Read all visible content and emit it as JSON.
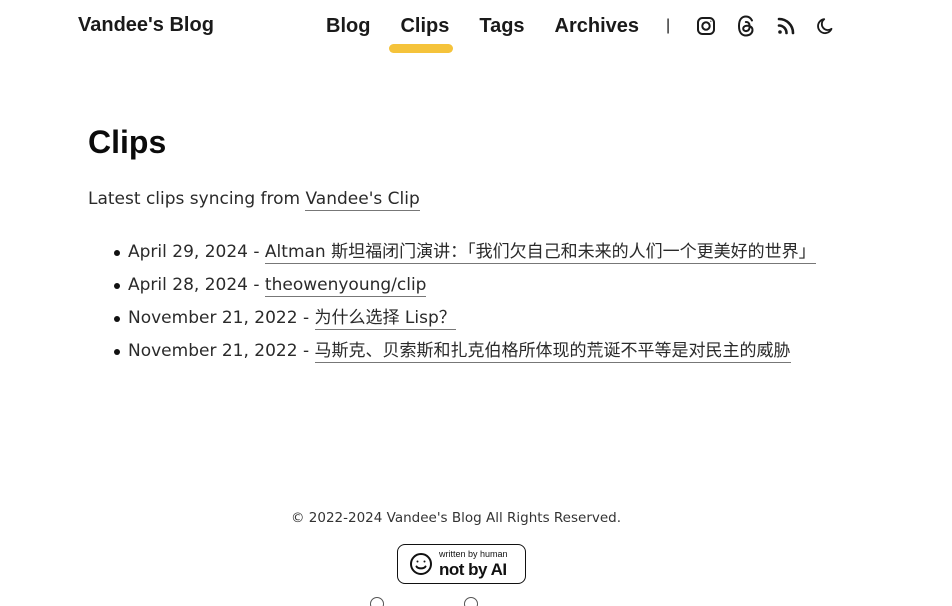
{
  "site": {
    "title": "Vandee's Blog"
  },
  "nav": {
    "links": [
      {
        "label": "Blog"
      },
      {
        "label": "Clips",
        "active": true
      },
      {
        "label": "Tags"
      },
      {
        "label": "Archives"
      }
    ],
    "separator": "|",
    "icons": [
      "instagram-icon",
      "threads-icon",
      "rss-icon",
      "moon-icon"
    ],
    "accent_color": "#f5c33b"
  },
  "main": {
    "title": "Clips",
    "intro_text": "Latest clips syncing from ",
    "intro_link": "Vandee's Clip",
    "clips": [
      {
        "date": "April 29, 2024",
        "title": "Altman 斯坦福闭门演讲：「我们欠自己和未来的人们一个更美好的世界」"
      },
      {
        "date": "April 28, 2024",
        "title": "theowenyoung/clip"
      },
      {
        "date": "November 21, 2022",
        "title": "为什么选择 Lisp？"
      },
      {
        "date": "November 21, 2022",
        "title": "马斯克、贝索斯和扎克伯格所体现的荒诞不平等是对民主的威胁"
      }
    ],
    "separator": " - "
  },
  "footer": {
    "copyright": "© 2022-2024 Vandee's Blog All Rights Reserved.",
    "badge_small": "written by human",
    "badge_big": "not by AI"
  }
}
